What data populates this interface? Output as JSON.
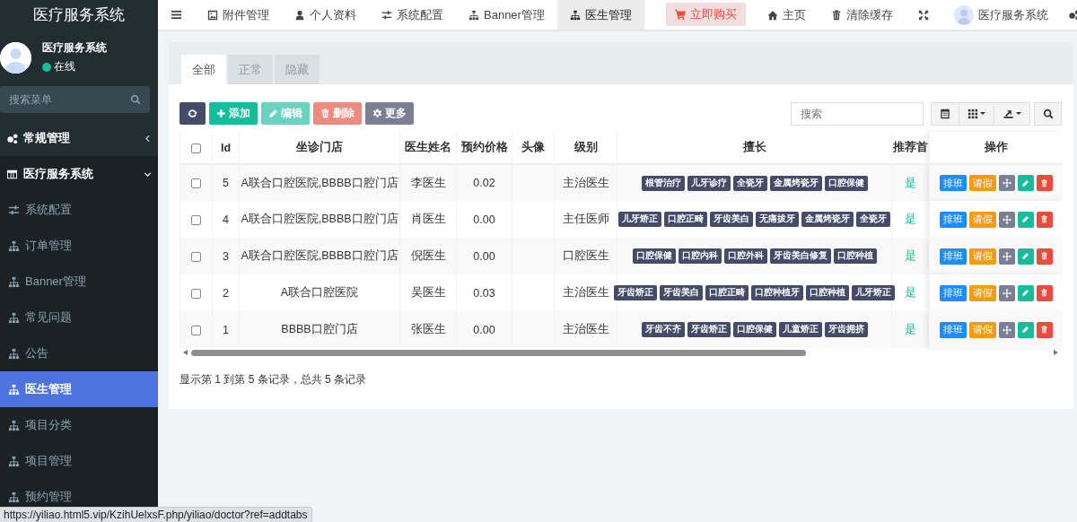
{
  "sidebar": {
    "logo": "医疗服务系统",
    "user": {
      "name": "医疗服务系统",
      "status": "在线",
      "online": true
    },
    "search": {
      "placeholder": "搜索菜单"
    },
    "menu": [
      {
        "label": "常规管理",
        "expanded": false
      },
      {
        "label": "医疗服务系统",
        "expanded": true,
        "children": [
          {
            "label": "系统配置",
            "selected": false
          },
          {
            "label": "订单管理",
            "selected": false
          },
          {
            "label": "Banner管理",
            "selected": false
          },
          {
            "label": "常见问题",
            "selected": false
          },
          {
            "label": "公告",
            "selected": false
          },
          {
            "label": "医生管理",
            "selected": true
          },
          {
            "label": "项目分类",
            "selected": false
          },
          {
            "label": "项目管理",
            "selected": false
          },
          {
            "label": "预约管理",
            "selected": false
          }
        ]
      }
    ]
  },
  "header": {
    "nav_tabs": [
      {
        "label": "附件管理",
        "selected": false
      },
      {
        "label": "个人资料",
        "selected": false
      },
      {
        "label": "系统配置",
        "selected": false
      },
      {
        "label": "Banner管理",
        "selected": false
      },
      {
        "label": "医生管理",
        "selected": true
      }
    ],
    "buy_button": "立即购买",
    "links": [
      "主页",
      "清除缓存"
    ],
    "account": "医疗服务系统"
  },
  "page_tabs": [
    {
      "label": "全部",
      "selected": true
    },
    {
      "label": "正常",
      "selected": false
    },
    {
      "label": "隐藏",
      "selected": false
    }
  ],
  "toolbar": {
    "buttons": [
      {
        "kind": "refresh",
        "disabled": false
      },
      {
        "kind": "add",
        "label": "添加",
        "disabled": false
      },
      {
        "kind": "edit",
        "label": "编辑",
        "disabled": true
      },
      {
        "kind": "delete",
        "label": "删除",
        "disabled": true
      },
      {
        "kind": "more",
        "label": "更多",
        "disabled": false
      }
    ],
    "search": {
      "placeholder": "搜索"
    }
  },
  "table": {
    "all_checked": false,
    "columns": [
      "Id",
      "坐诊门店",
      "医生姓名",
      "预约价格",
      "头像",
      "级别",
      "擅长",
      "推荐首",
      "操作"
    ],
    "rows": [
      {
        "checked": false,
        "id": "5",
        "clinic": "A联合口腔医院,BBBB口腔门店",
        "doctor": "李医生",
        "price": "0.02",
        "level": "主治医生",
        "specialties": [
          "根管治疗",
          "儿牙诊疗",
          "全瓷牙",
          "金属烤瓷牙",
          "口腔保健"
        ],
        "recommended": "是",
        "actions": [
          "排班",
          "请假"
        ]
      },
      {
        "checked": false,
        "id": "4",
        "clinic": "A联合口腔医院,BBBB口腔门店",
        "doctor": "肖医生",
        "price": "0.00",
        "level": "主任医师",
        "specialties": [
          "儿牙矫正",
          "口腔正畸",
          "牙齿美白",
          "无痛拔牙",
          "金属烤瓷牙",
          "全瓷牙"
        ],
        "recommended": "是",
        "actions": [
          "排班",
          "请假"
        ]
      },
      {
        "checked": false,
        "id": "3",
        "clinic": "A联合口腔医院,BBBB口腔门店",
        "doctor": "倪医生",
        "price": "0.00",
        "level": "口腔医生",
        "specialties": [
          "口腔保健",
          "口腔内科",
          "口腔外科",
          "牙齿美白修复",
          "口腔种植"
        ],
        "recommended": "是",
        "actions": [
          "排班",
          "请假"
        ]
      },
      {
        "checked": false,
        "id": "2",
        "clinic": "A联合口腔医院",
        "doctor": "吴医生",
        "price": "0.03",
        "level": "主治医生",
        "specialties": [
          "牙齿矫正",
          "牙齿美白",
          "口腔正畸",
          "口腔种植牙",
          "口腔种植",
          "儿牙矫正"
        ],
        "recommended": "是",
        "actions": [
          "排班",
          "请假"
        ]
      },
      {
        "checked": false,
        "id": "1",
        "clinic": "BBBB口腔门店",
        "doctor": "张医生",
        "price": "0.00",
        "level": "主治医生",
        "specialties": [
          "牙齿不齐",
          "牙齿矫正",
          "口腔保健",
          "儿童矫正",
          "牙齿拥挤"
        ],
        "recommended": "是",
        "actions": [
          "排班",
          "请假"
        ]
      }
    ]
  },
  "pagination_info": "显示第 1 到第 5 条记录，总共 5 条记录",
  "status_bar": "https://yiliao.html5.vip/KzihUelxsF.php/yiliao/doctor?ref=addtabs"
}
